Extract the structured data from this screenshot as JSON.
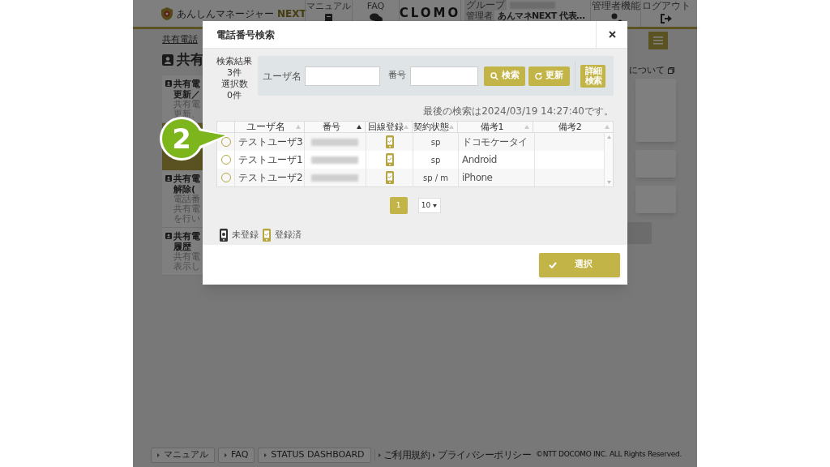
{
  "app_header": {
    "brand": "あんしんマネージャー",
    "brand_suffix": "NEXT",
    "nav": [
      "マニュアル",
      "FAQ"
    ],
    "logo": "CLOMO",
    "group_label": "グループ",
    "admin_label": "管理者",
    "admin_name": "あんマネNEXT 代表…",
    "actions": [
      "管理者機能",
      "ログアウト"
    ]
  },
  "background": {
    "breadcrumb": "共有電話",
    "title": "共有",
    "cards": [
      {
        "title": [
          "共有電",
          "更新／"
        ],
        "desc": [
          "共有電",
          "更新、"
        ],
        "selected": false
      },
      {
        "selected": true
      },
      {
        "title": [
          "共有電",
          "解除("
        ],
        "desc": [
          "電話番",
          "共有電",
          "を行い"
        ],
        "selected": false
      },
      {
        "title": [
          "共有電",
          "履歴"
        ],
        "desc": [
          "共有電",
          "表示し"
        ],
        "selected": false
      }
    ],
    "right_link": "について"
  },
  "footer": {
    "buttons": [
      "マニュアル",
      "FAQ",
      "STATUS DASHBOARD"
    ],
    "links": [
      "ご利用規約",
      "プライバシーポリシー"
    ],
    "copyright": "©NTT DOCOMO INC. ALL Rights Reserved."
  },
  "dialog": {
    "title": "電話番号検索",
    "summary": [
      "検索結果",
      "3件",
      "選択数",
      "0件"
    ],
    "search": {
      "user_label": "ユーザ名",
      "number_label": "番号",
      "search_button": "検索",
      "refresh_button": "更新",
      "advanced_button": "詳細検索"
    },
    "last_search": "最後の検索は2024/03/19 14:27:40です。",
    "columns": [
      {
        "label": "ユーザ名",
        "sorted": false
      },
      {
        "label": "番号",
        "sorted": true
      },
      {
        "label": "回線登録",
        "sorted": false
      },
      {
        "label": "契約状態",
        "sorted": false
      },
      {
        "label": "備考1",
        "sorted": false
      },
      {
        "label": "備考2",
        "sorted": false
      }
    ],
    "rows": [
      {
        "selected": false,
        "user": "テストユーザ3",
        "registered": true,
        "contract": "sp",
        "note1": "ドコモケータイ"
      },
      {
        "selected": false,
        "user": "テストユーザ1",
        "registered": true,
        "contract": "sp",
        "note1": "Android"
      },
      {
        "selected": false,
        "user": "テストユーザ2",
        "registered": true,
        "contract": "sp / m",
        "note1": "iPhone"
      }
    ],
    "pages": [
      {
        "label": "1",
        "selected": true
      }
    ],
    "page_size": "10",
    "legend": [
      {
        "registered": false,
        "label": "未登録"
      },
      {
        "registered": true,
        "label": "登録済"
      }
    ],
    "confirm_button": "選択"
  },
  "callout": "2"
}
